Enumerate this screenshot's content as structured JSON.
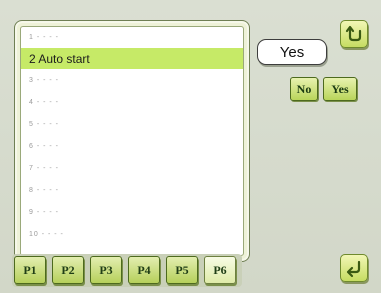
{
  "list": {
    "items": [
      {
        "label": "1 - - - -"
      },
      {
        "label": "2 Auto start"
      },
      {
        "label": "3 - - - -"
      },
      {
        "label": "4 - - - -"
      },
      {
        "label": "5 - - - -"
      },
      {
        "label": "6 - - - -"
      },
      {
        "label": "7 - - - -"
      },
      {
        "label": "8 - - - -"
      },
      {
        "label": "9 - - - -"
      },
      {
        "label": "10 - - - -"
      }
    ],
    "selected_index": 1
  },
  "value_display": {
    "text": "Yes"
  },
  "choices": {
    "no_label": "No",
    "yes_label": "Yes"
  },
  "pages": {
    "tabs": [
      "P1",
      "P2",
      "P3",
      "P4",
      "P5",
      "P6"
    ],
    "active_index": 5
  },
  "icons": {
    "top": "return-arrow-icon",
    "bottom": "enter-return-icon"
  },
  "colors": {
    "selection": "#c6ea67",
    "button_green": "#b9d55a"
  }
}
